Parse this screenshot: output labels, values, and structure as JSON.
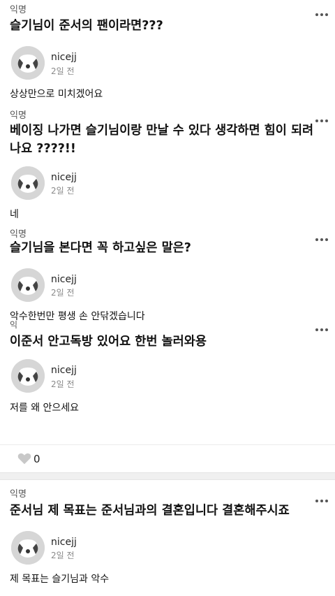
{
  "posts": [
    {
      "asker": "익명",
      "question": "슬기님이 준서의 팬이라면???",
      "user": "nicejj",
      "time": "2일 전",
      "answer": "상상만으로 미치겠어요"
    },
    {
      "asker": "익명",
      "question": "베이징 나가면 슬기님이랑 만날 수 있다 생각하면 힘이 되려나요 ????!!",
      "user": "nicejj",
      "time": "2일 전",
      "answer": "네"
    },
    {
      "asker": "익명",
      "question": "슬기님을 본다면 꼭 하고싶은 말은?",
      "user": "nicejj",
      "time": "2일 전",
      "answer": "악수한번만 평생 손 안닦겠습니다"
    },
    {
      "asker": "익",
      "question": "이준서 안고독방 있어요 한번 놀러와용",
      "user": "nicejj",
      "time": "2일 전",
      "answer": "저를 왜 안으세요"
    },
    {
      "asker": "익명",
      "question": "준서님 제 목표는 준서님과의 결혼입니다 결혼해주시죠",
      "user": "nicejj",
      "time": "2일 전",
      "answer": "제 목표는 슬기님과 악수"
    }
  ],
  "likes": {
    "count": "0",
    "icon": "heart-icon"
  }
}
